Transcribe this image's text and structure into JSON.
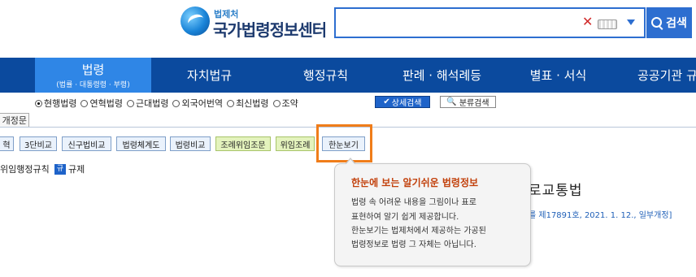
{
  "header": {
    "logo_small": "법제처",
    "logo_main": "국가법령정보센터",
    "search_placeholder": "",
    "search_button_label": "검색"
  },
  "nav": {
    "tabs": [
      {
        "label": "법령",
        "sub": "(법률 · 대통령령 · 부령)",
        "active": true
      },
      {
        "label": "자치법규"
      },
      {
        "label": "행정규칙"
      },
      {
        "label": "판례 · 해석례등"
      },
      {
        "label": "별표 · 서식"
      },
      {
        "label": "공공기관 규"
      }
    ]
  },
  "filters": {
    "radios": [
      {
        "label": "현행법령",
        "selected": true
      },
      {
        "label": "연혁법령",
        "selected": false
      },
      {
        "label": "근대법령",
        "selected": false
      },
      {
        "label": "외국어번역",
        "selected": false
      },
      {
        "label": "최신법령",
        "selected": false
      },
      {
        "label": "조약",
        "selected": false
      }
    ],
    "detail_search": "상세검색",
    "class_search": "분류검색"
  },
  "amend_tab": "개정문",
  "tools": [
    {
      "label": "혁"
    },
    {
      "label": "3단비교"
    },
    {
      "label": "신구법비교"
    },
    {
      "label": "법령체계도"
    },
    {
      "label": "법령비교"
    },
    {
      "label": "조례위임조문"
    },
    {
      "label": "위임조례"
    },
    {
      "label": "한눈보기"
    }
  ],
  "category_row": {
    "prefix": "위임행정규칙",
    "badge": "규",
    "label": "규제"
  },
  "law": {
    "title": "로교통법",
    "info": "를 제17891호, 2021. 1. 12., 일부개정]"
  },
  "tooltip": {
    "title": "한눈에 보는 알기쉬운 법령정보",
    "lines": [
      "법령 속 어려운 내용을 그림이나 표로",
      "표현하여 알기 쉽게 제공합니다.",
      "한눈보기는 법제처에서 제공하는 가공된",
      "법령정보로 법령 그 자체는 아닙니다."
    ]
  },
  "colors": {
    "nav_bg": "#0b4a9e",
    "nav_active": "#2f86e6",
    "highlight": "#f07d1a",
    "tooltip_title": "#c2410c"
  }
}
